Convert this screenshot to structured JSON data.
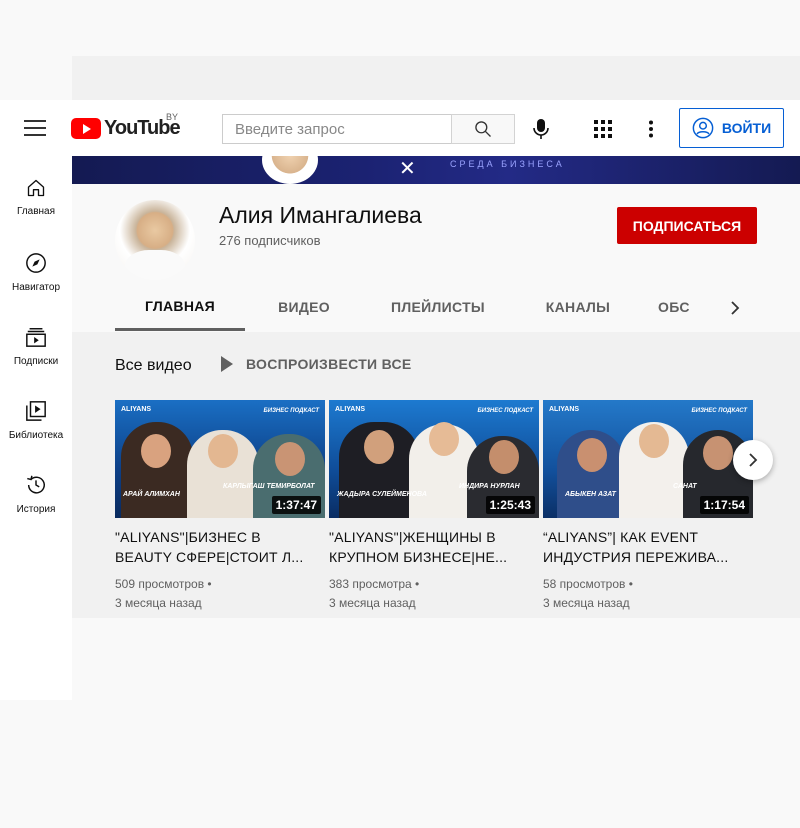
{
  "masthead": {
    "logo_text": "YouTube",
    "region": "BY",
    "search_placeholder": "Введите запрос",
    "signin_label": "ВОЙТИ"
  },
  "sidebar": {
    "items": [
      {
        "label": "Главная",
        "icon": "home-icon"
      },
      {
        "label": "Навигатор",
        "icon": "compass-icon"
      },
      {
        "label": "Подписки",
        "icon": "subscriptions-icon"
      },
      {
        "label": "Библиотека",
        "icon": "library-icon"
      },
      {
        "label": "История",
        "icon": "history-icon"
      }
    ]
  },
  "banner": {
    "text": "СРЕДА БИЗНЕСА"
  },
  "channel": {
    "name": "Алия Имангалиева",
    "subscribers": "276 подписчиков",
    "subscribe_label": "ПОДПИСАТЬСЯ",
    "tabs": [
      "ГЛАВНАЯ",
      "ВИДЕО",
      "ПЛЕЙЛИСТЫ",
      "КАНАЛЫ",
      "ОБС"
    ],
    "active_tab": "ГЛАВНАЯ"
  },
  "section": {
    "title": "Все видео",
    "play_all_label": "ВОСПРОИЗВЕСТИ ВСЕ"
  },
  "videos": [
    {
      "title_line1": "\"ALIYANS\"|БИЗНЕС В",
      "title_line2": "BEAUTY СФЕРЕ|СТОИТ Л...",
      "duration": "1:37:47",
      "views": "509 просмотров",
      "age": "3 месяца назад",
      "thumb_brand": "ALIYANS",
      "thumb_tag": "БИЗНЕС ПОДКАСТ",
      "thumb_names": [
        "АРАЙ АЛИМХАН",
        "КАРЛЫГАШ ТЕМИРБОЛАТ"
      ]
    },
    {
      "title_line1": "\"ALIYANS\"|ЖЕНЩИНЫ В",
      "title_line2": "КРУПНОМ БИЗНЕСЕ|НЕ...",
      "duration": "1:25:43",
      "views": "383 просмотра",
      "age": "3 месяца назад",
      "thumb_brand": "ALIYANS",
      "thumb_tag": "БИЗНЕС ПОДКАСТ",
      "thumb_names": [
        "ЖАДЫРА СУЛЕЙМЕНОВА",
        "ИНДИРА НУРЛАН"
      ]
    },
    {
      "title_line1": "“ALIYANS”| КАК EVENT",
      "title_line2": "ИНДУСТРИЯ ПЕРЕЖИВА...",
      "duration": "1:17:54",
      "views": "58 просмотров",
      "age": "3 месяца назад",
      "thumb_brand": "ALIYANS",
      "thumb_tag": "БИЗНЕС ПОДКАСТ",
      "thumb_names": [
        "АБЫКЕН АЗАТ",
        "САНАТ"
      ]
    }
  ],
  "colors": {
    "brand_red": "#ff0000",
    "subscribe_red": "#cc0000",
    "link_blue": "#065fd4",
    "banner_navy": "#1b2272"
  }
}
